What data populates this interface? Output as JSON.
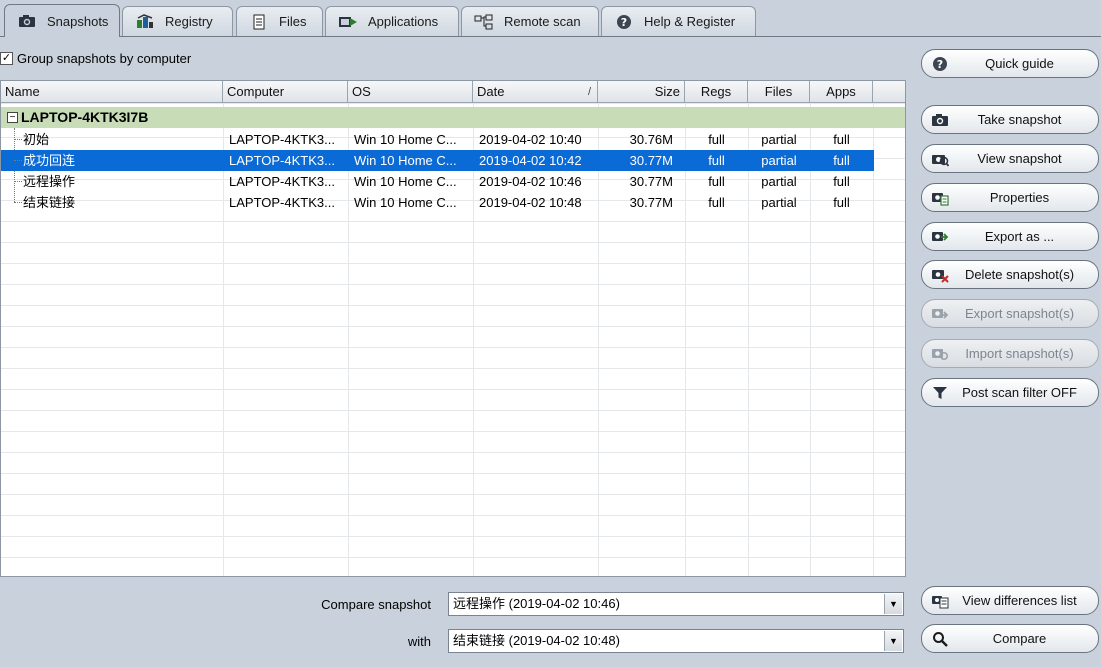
{
  "tabs": [
    {
      "label": "Snapshots",
      "icon": "camera-icon",
      "active": true
    },
    {
      "label": "Registry",
      "icon": "registry-icon"
    },
    {
      "label": "Files",
      "icon": "file-icon"
    },
    {
      "label": "Applications",
      "icon": "applications-icon"
    },
    {
      "label": "Remote scan",
      "icon": "network-icon"
    },
    {
      "label": "Help & Register",
      "icon": "help-icon"
    }
  ],
  "group_checkbox": {
    "label": "Group snapshots by computer",
    "checked": true
  },
  "columns": [
    {
      "label": "Name"
    },
    {
      "label": "Computer"
    },
    {
      "label": "OS"
    },
    {
      "label": "Date",
      "sort": "/"
    },
    {
      "label": "Size"
    },
    {
      "label": "Regs"
    },
    {
      "label": "Files"
    },
    {
      "label": "Apps"
    }
  ],
  "group": {
    "expander": "−",
    "name": "LAPTOP-4KTK3I7B"
  },
  "snapshots": [
    {
      "name": "初始",
      "computer": "LAPTOP-4KTK3...",
      "os": "Win 10 Home C...",
      "date": "2019-04-02 10:40",
      "size": "30.76M",
      "regs": "full",
      "files": "partial",
      "apps": "full",
      "selected": false
    },
    {
      "name": "成功回连",
      "computer": "LAPTOP-4KTK3...",
      "os": "Win 10 Home C...",
      "date": "2019-04-02 10:42",
      "size": "30.77M",
      "regs": "full",
      "files": "partial",
      "apps": "full",
      "selected": true
    },
    {
      "name": "远程操作",
      "computer": "LAPTOP-4KTK3...",
      "os": "Win 10 Home C...",
      "date": "2019-04-02 10:46",
      "size": "30.77M",
      "regs": "full",
      "files": "partial",
      "apps": "full",
      "selected": false
    },
    {
      "name": "结束链接",
      "computer": "LAPTOP-4KTK3...",
      "os": "Win 10 Home C...",
      "date": "2019-04-02 10:48",
      "size": "30.77M",
      "regs": "full",
      "files": "partial",
      "apps": "full",
      "selected": false
    }
  ],
  "buttons": {
    "quick_guide": "Quick guide",
    "take_snapshot": "Take snapshot",
    "view_snapshot": "View snapshot",
    "properties": "Properties",
    "export_as": "Export as ...",
    "delete_snapshots": "Delete snapshot(s)",
    "export_snapshots": "Export snapshot(s)",
    "import_snapshots": "Import snapshot(s)",
    "post_scan_filter": "Post scan filter OFF",
    "view_differences": "View differences list",
    "compare": "Compare"
  },
  "compare": {
    "label": "Compare snapshot",
    "value": "远程操作 (2019-04-02 10:46)",
    "with_label": "with",
    "with_value": "结束链接 (2019-04-02 10:48)"
  },
  "colors": {
    "selected_row": "#0a6ad6",
    "group_row": "#c8dcb8",
    "background": "#c9d2dc"
  }
}
